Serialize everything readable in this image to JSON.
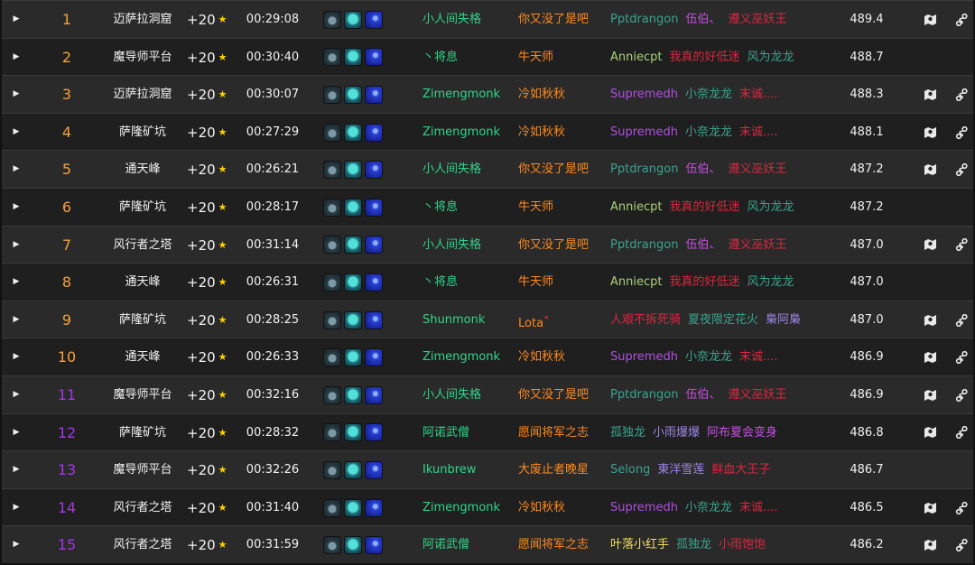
{
  "columns_hint": "rank, dungeon, level, time, affixes, tank, healer, dps, score",
  "class_colors": {
    "monk": "#00ff98",
    "mage": "#3fc7eb",
    "shaman": "#0070dd",
    "druid": "#ff7c0a",
    "priest": "#ffffff",
    "evoker": "#33937f",
    "warlock": "#8788ee",
    "demonhunter": "#a330c9",
    "deathknight": "#c41e3a",
    "paladin": "#f48cba",
    "rogue": "#fff468",
    "hunter": "#aad372"
  },
  "rank_colors": {
    "orange": "#f5a33b",
    "purple": "#a335ee"
  },
  "level_suffix": "★",
  "icons": [
    "map-icon",
    "route-icon"
  ],
  "rows": [
    {
      "rank": "1",
      "rank_color": "#f5a33b",
      "dungeon": "迈萨拉洞窟",
      "level": "+20",
      "time": "00:29:08",
      "tank": {
        "name": "小人间失格",
        "color": "#2fd68a"
      },
      "healer": {
        "name": "你又没了是吧",
        "color": "#ff8a1f"
      },
      "dps": [
        {
          "name": "Pptdrangon",
          "color": "#3aa38f"
        },
        {
          "name": "伍伯、",
          "color": "#c54fe0"
        },
        {
          "name": "遵义巫妖王",
          "color": "#d9283f"
        }
      ],
      "score": "489.4",
      "has_icons": true
    },
    {
      "rank": "2",
      "rank_color": "#f5a33b",
      "dungeon": "魔导师平台",
      "level": "+20",
      "time": "00:30:40",
      "tank": {
        "name": "丶将息",
        "color": "#2fd68a"
      },
      "healer": {
        "name": "牛天师",
        "color": "#ff8a1f"
      },
      "dps": [
        {
          "name": "Anniecpt",
          "color": "#a9d27a"
        },
        {
          "name": "我真的好低迷",
          "color": "#d9283f"
        },
        {
          "name": "风为龙龙",
          "color": "#3aa38f"
        }
      ],
      "score": "488.7",
      "has_icons": false
    },
    {
      "rank": "3",
      "rank_color": "#f5a33b",
      "dungeon": "迈萨拉洞窟",
      "level": "+20",
      "time": "00:30:07",
      "tank": {
        "name": "Zimengmonk",
        "color": "#2fd68a"
      },
      "healer": {
        "name": "冷如秋秋",
        "color": "#ff8a1f"
      },
      "dps": [
        {
          "name": "Supremedh",
          "color": "#b04fe0"
        },
        {
          "name": "小奈龙龙",
          "color": "#3aa38f"
        },
        {
          "name": "末诚....",
          "color": "#d9283f"
        }
      ],
      "score": "488.3",
      "has_icons": true
    },
    {
      "rank": "4",
      "rank_color": "#f5a33b",
      "dungeon": "萨隆矿坑",
      "level": "+20",
      "time": "00:27:29",
      "tank": {
        "name": "Zimengmonk",
        "color": "#2fd68a"
      },
      "healer": {
        "name": "冷如秋秋",
        "color": "#ff8a1f"
      },
      "dps": [
        {
          "name": "Supremedh",
          "color": "#b04fe0"
        },
        {
          "name": "小奈龙龙",
          "color": "#3aa38f"
        },
        {
          "name": "末诚....",
          "color": "#d9283f"
        }
      ],
      "score": "488.1",
      "has_icons": true
    },
    {
      "rank": "5",
      "rank_color": "#f5a33b",
      "dungeon": "通天峰",
      "level": "+20",
      "time": "00:26:21",
      "tank": {
        "name": "小人间失格",
        "color": "#2fd68a"
      },
      "healer": {
        "name": "你又没了是吧",
        "color": "#ff8a1f"
      },
      "dps": [
        {
          "name": "Pptdrangon",
          "color": "#3aa38f"
        },
        {
          "name": "伍伯、",
          "color": "#c54fe0"
        },
        {
          "name": "遵义巫妖王",
          "color": "#d9283f"
        }
      ],
      "score": "487.2",
      "has_icons": true
    },
    {
      "rank": "6",
      "rank_color": "#f5a33b",
      "dungeon": "萨隆矿坑",
      "level": "+20",
      "time": "00:28:17",
      "tank": {
        "name": "丶将息",
        "color": "#2fd68a"
      },
      "healer": {
        "name": "牛天师",
        "color": "#ff8a1f"
      },
      "dps": [
        {
          "name": "Anniecpt",
          "color": "#a9d27a"
        },
        {
          "name": "我真的好低迷",
          "color": "#d9283f"
        },
        {
          "name": "风为龙龙",
          "color": "#3aa38f"
        }
      ],
      "score": "487.2",
      "has_icons": false
    },
    {
      "rank": "7",
      "rank_color": "#f5a33b",
      "dungeon": "风行者之塔",
      "level": "+20",
      "time": "00:31:14",
      "tank": {
        "name": "小人间失格",
        "color": "#2fd68a"
      },
      "healer": {
        "name": "你又没了是吧",
        "color": "#ff8a1f"
      },
      "dps": [
        {
          "name": "Pptdrangon",
          "color": "#3aa38f"
        },
        {
          "name": "伍伯、",
          "color": "#c54fe0"
        },
        {
          "name": "遵义巫妖王",
          "color": "#d9283f"
        }
      ],
      "score": "487.0",
      "has_icons": true
    },
    {
      "rank": "8",
      "rank_color": "#f5a33b",
      "dungeon": "通天峰",
      "level": "+20",
      "time": "00:26:31",
      "tank": {
        "name": "丶将息",
        "color": "#2fd68a"
      },
      "healer": {
        "name": "牛天师",
        "color": "#ff8a1f"
      },
      "dps": [
        {
          "name": "Anniecpt",
          "color": "#a9d27a"
        },
        {
          "name": "我真的好低迷",
          "color": "#d9283f"
        },
        {
          "name": "风为龙龙",
          "color": "#3aa38f"
        }
      ],
      "score": "487.0",
      "has_icons": false
    },
    {
      "rank": "9",
      "rank_color": "#f5a33b",
      "dungeon": "萨隆矿坑",
      "level": "+20",
      "time": "00:28:25",
      "tank": {
        "name": "Shunmonk",
        "color": "#2fd68a"
      },
      "healer": {
        "name": "Lota",
        "color": "#ff8a1f",
        "sup": "*"
      },
      "dps": [
        {
          "name": "人艰不拆死骑",
          "color": "#d9283f"
        },
        {
          "name": "夏夜限定花火",
          "color": "#3aa38f"
        },
        {
          "name": "梟阿梟",
          "color": "#9a86e8"
        }
      ],
      "score": "487.0",
      "has_icons": true
    },
    {
      "rank": "10",
      "rank_color": "#f5a33b",
      "dungeon": "通天峰",
      "level": "+20",
      "time": "00:26:33",
      "tank": {
        "name": "Zimengmonk",
        "color": "#2fd68a"
      },
      "healer": {
        "name": "冷如秋秋",
        "color": "#ff8a1f"
      },
      "dps": [
        {
          "name": "Supremedh",
          "color": "#b04fe0"
        },
        {
          "name": "小奈龙龙",
          "color": "#3aa38f"
        },
        {
          "name": "末诚....",
          "color": "#d9283f"
        }
      ],
      "score": "486.9",
      "has_icons": true
    },
    {
      "rank": "11",
      "rank_color": "#a335ee",
      "dungeon": "魔导师平台",
      "level": "+20",
      "time": "00:32:16",
      "tank": {
        "name": "小人间失格",
        "color": "#2fd68a"
      },
      "healer": {
        "name": "你又没了是吧",
        "color": "#ff8a1f"
      },
      "dps": [
        {
          "name": "Pptdrangon",
          "color": "#3aa38f"
        },
        {
          "name": "伍伯、",
          "color": "#c54fe0"
        },
        {
          "name": "遵义巫妖王",
          "color": "#d9283f"
        }
      ],
      "score": "486.9",
      "has_icons": true
    },
    {
      "rank": "12",
      "rank_color": "#a335ee",
      "dungeon": "萨隆矿坑",
      "level": "+20",
      "time": "00:28:32",
      "tank": {
        "name": "阿诺武僧",
        "color": "#2fd68a"
      },
      "healer": {
        "name": "愿闻将军之志",
        "color": "#ff8a1f"
      },
      "dps": [
        {
          "name": "孤独龙",
          "color": "#3aa38f"
        },
        {
          "name": "小雨爆爆",
          "color": "#9a86e8"
        },
        {
          "name": "阿布夏会变身",
          "color": "#c54fe0"
        }
      ],
      "score": "486.8",
      "has_icons": true
    },
    {
      "rank": "13",
      "rank_color": "#a335ee",
      "dungeon": "魔导师平台",
      "level": "+20",
      "time": "00:32:26",
      "tank": {
        "name": "Ikunbrew",
        "color": "#2fd68a"
      },
      "healer": {
        "name": "大废止者晚星",
        "color": "#ff8a1f"
      },
      "dps": [
        {
          "name": "Selong",
          "color": "#3aa38f"
        },
        {
          "name": "東洋雪莲",
          "color": "#9a86e8"
        },
        {
          "name": "鲜血大王子",
          "color": "#d9283f"
        }
      ],
      "score": "486.7",
      "has_icons": false
    },
    {
      "rank": "14",
      "rank_color": "#a335ee",
      "dungeon": "风行者之塔",
      "level": "+20",
      "time": "00:31:40",
      "tank": {
        "name": "Zimengmonk",
        "color": "#2fd68a"
      },
      "healer": {
        "name": "冷如秋秋",
        "color": "#ff8a1f"
      },
      "dps": [
        {
          "name": "Supremedh",
          "color": "#b04fe0"
        },
        {
          "name": "小奈龙龙",
          "color": "#3aa38f"
        },
        {
          "name": "末诚....",
          "color": "#d9283f"
        }
      ],
      "score": "486.5",
      "has_icons": true
    },
    {
      "rank": "15",
      "rank_color": "#a335ee",
      "dungeon": "风行者之塔",
      "level": "+20",
      "time": "00:31:59",
      "tank": {
        "name": "阿诺武僧",
        "color": "#2fd68a"
      },
      "healer": {
        "name": "愿闻将军之志",
        "color": "#ff8a1f"
      },
      "dps": [
        {
          "name": "叶落小红手",
          "color": "#f0e05a"
        },
        {
          "name": "孤独龙",
          "color": "#3aa38f"
        },
        {
          "name": "小雨饱饱",
          "color": "#d9283f"
        }
      ],
      "score": "486.2",
      "has_icons": true
    }
  ]
}
